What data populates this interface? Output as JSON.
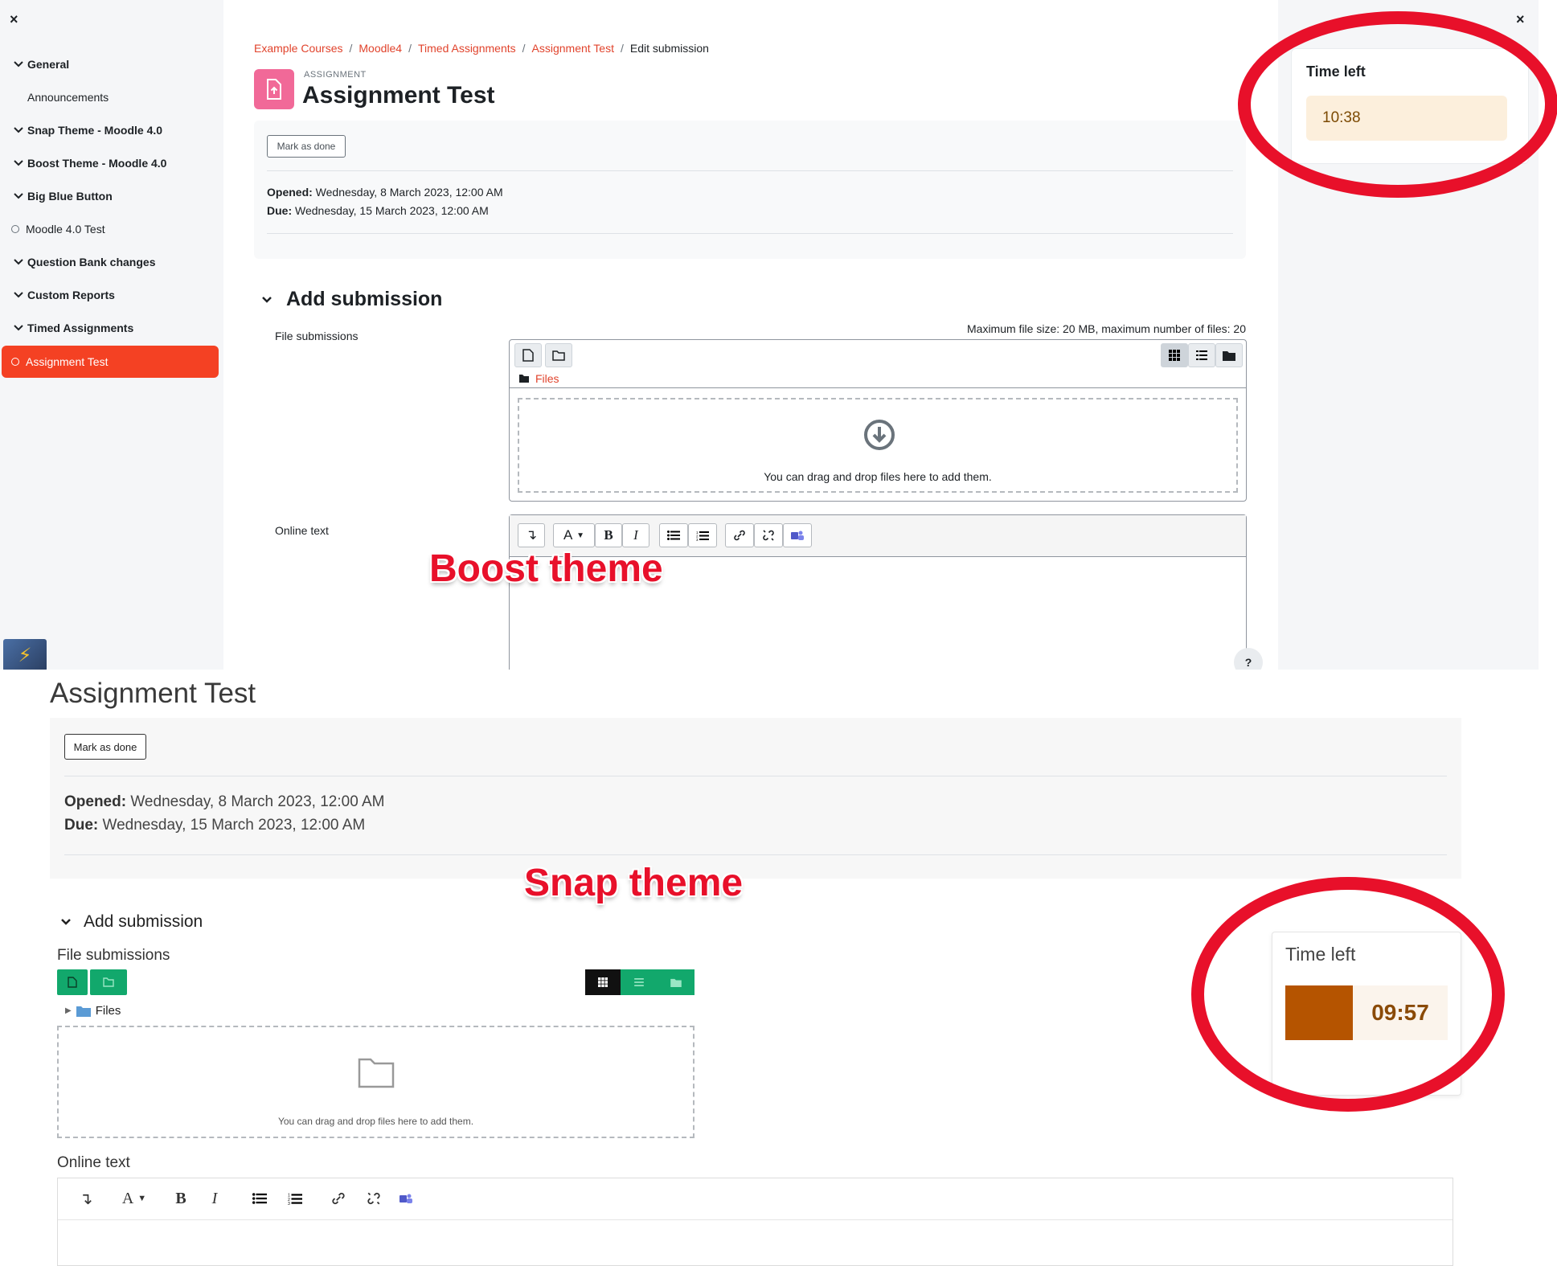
{
  "boost": {
    "close_label": "×",
    "nav": [
      {
        "label": "General",
        "type": "section"
      },
      {
        "label": "Announcements",
        "type": "sub"
      },
      {
        "label": "Snap Theme - Moodle 4.0",
        "type": "section"
      },
      {
        "label": "Boost Theme - Moodle 4.0",
        "type": "section"
      },
      {
        "label": "Big Blue Button",
        "type": "section"
      },
      {
        "label": "Moodle 4.0 Test",
        "type": "activity"
      },
      {
        "label": "Question Bank changes",
        "type": "section"
      },
      {
        "label": "Custom Reports",
        "type": "section"
      },
      {
        "label": "Timed Assignments",
        "type": "section"
      },
      {
        "label": "Assignment Test",
        "type": "active"
      }
    ],
    "breadcrumb": [
      "Example Courses",
      "Moodle4",
      "Timed Assignments",
      "Assignment Test",
      "Edit submission"
    ],
    "breadcrumb_sep": "/",
    "kicker": "ASSIGNMENT",
    "title": "Assignment Test",
    "mark_done": "Mark as done",
    "opened_label": "Opened:",
    "opened_value": " Wednesday, 8 March 2023, 12:00 AM",
    "due_label": "Due:",
    "due_value": " Wednesday, 15 March 2023, 12:00 AM",
    "add_submission": "Add submission",
    "file_submissions": "File submissions",
    "max_size": "Maximum file size: 20 MB, maximum number of files: 20",
    "files_folder": "Files",
    "drop_text": "You can drag and drop files here to add them.",
    "online_text": "Online text",
    "editor_buttons": {
      "bold": "B",
      "italic": "I",
      "font": "A"
    },
    "help": "?",
    "time_left_title": "Time left",
    "time_left_value": "10:38",
    "annotation": "Boost theme"
  },
  "snap": {
    "title": "Assignment Test",
    "mark_done": "Mark as done",
    "opened_label": "Opened:",
    "opened_value": " Wednesday, 8 March 2023, 12:00 AM",
    "due_label": "Due:",
    "due_value": " Wednesday, 15 March 2023, 12:00 AM",
    "add_submission": "Add submission",
    "file_submissions": "File submissions",
    "files_folder": "Files",
    "drop_text": "You can drag and drop files here to add them.",
    "online_text": "Online text",
    "editor_buttons": {
      "bold": "B",
      "italic": "I",
      "font": "A"
    },
    "time_left_title": "Time left",
    "time_left_value": "09:57",
    "annotation": "Snap theme"
  },
  "colors": {
    "accent": "#f44123",
    "link": "#e1432c",
    "annotation_red": "#e8102a",
    "snap_green": "#12a86c",
    "snap_timer_swatch": "#b55400"
  }
}
